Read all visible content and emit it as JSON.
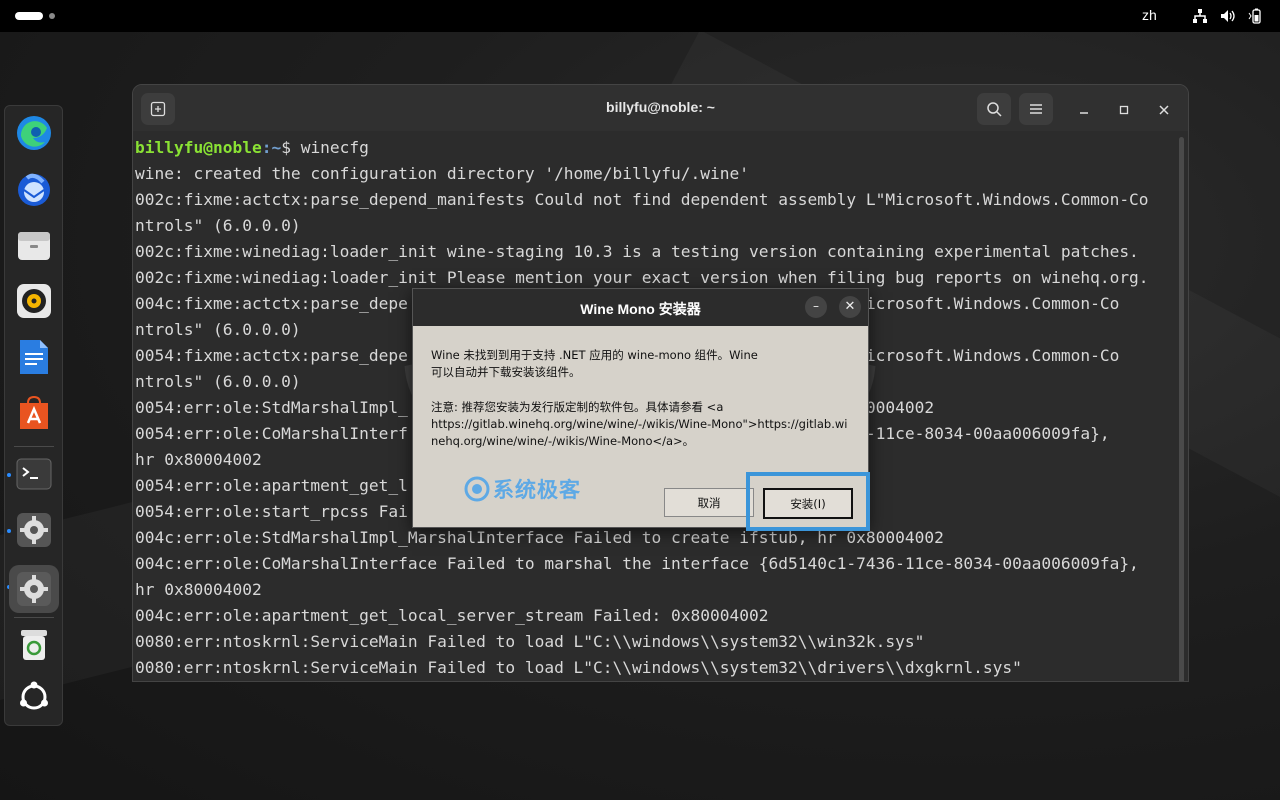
{
  "topbar": {
    "language": "zh"
  },
  "dock": {
    "items": [
      {
        "name": "edge-icon"
      },
      {
        "name": "thunderbird-icon"
      },
      {
        "name": "files-icon"
      },
      {
        "name": "rhythmbox-icon"
      },
      {
        "name": "writer-icon"
      },
      {
        "name": "app-center-icon"
      },
      {
        "name": "terminal-icon"
      },
      {
        "name": "settings-icon"
      },
      {
        "name": "settings-icon"
      },
      {
        "name": "trash-icon"
      },
      {
        "name": "ubuntu-icon"
      }
    ]
  },
  "terminal": {
    "title": "billyfu@noble: ~",
    "prompt_user": "billyfu@noble",
    "prompt_path": ":~",
    "command": "$ winecfg",
    "lines": [
      "wine: created the configuration directory '/home/billyfu/.wine'",
      "002c:fixme:actctx:parse_depend_manifests Could not find dependent assembly L\"Microsoft.Windows.Common-Co",
      "ntrols\" (6.0.0.0)",
      "002c:fixme:winediag:loader_init wine-staging 10.3 is a testing version containing experimental patches.",
      "002c:fixme:winediag:loader_init Please mention your exact version when filing bug reports on winehq.org.",
      "004c:fixme:actctx:parse_depe                                          y L\"Microsoft.Windows.Common-Co",
      "ntrols\" (6.0.0.0)",
      "0054:fixme:actctx:parse_depe                                          y L\"Microsoft.Windows.Common-Co",
      "ntrols\" (6.0.0.0)",
      "0054:err:ole:StdMarshalImpl_                                            0x80004002",
      "0054:err:ole:CoMarshalInterf                                          -7436-11ce-8034-00aa006009fa},",
      "hr 0x80004002",
      "0054:err:ole:apartment_get_l",
      "0054:err:ole:start_rpcss Fai",
      "004c:err:ole:StdMarshalImpl_MarshalInterface Failed to create ifstub, hr 0x80004002",
      "004c:err:ole:CoMarshalInterface Failed to marshal the interface {6d5140c1-7436-11ce-8034-00aa006009fa},",
      "hr 0x80004002",
      "004c:err:ole:apartment_get_local_server_stream Failed: 0x80004002",
      "0080:err:ntoskrnl:ServiceMain Failed to load L\"C:\\\\windows\\\\system32\\\\win32k.sys\"",
      "0080:err:ntoskrnl:ServiceMain Failed to load L\"C:\\\\windows\\\\system32\\\\drivers\\\\dxgkrnl.sys\""
    ]
  },
  "dialog": {
    "title": "Wine Mono 安装器",
    "message_line1": "Wine 未找到到用于支持 .NET 应用的 wine-mono 组件。Wine",
    "message_line2": "可以自动并下载安装该组件。",
    "note_line1": "注意: 推荐您安装为发行版定制的软件包。具体请参看 <a",
    "note_line2": "https://gitlab.winehq.org/wine/wine/-/wikis/Wine-Mono\">https://gitlab.wi",
    "note_line3": "nehq.org/wine/wine/-/wikis/Wine-Mono</a>。",
    "cancel_label": "取消",
    "install_label": "安装(I)",
    "minimize_label": "–",
    "close_label": "✕"
  },
  "watermark": {
    "text": "系统极客"
  },
  "colors": {
    "accent": "#3b95d9",
    "prompt_user": "#8ae234",
    "prompt_path": "#729fcf"
  }
}
